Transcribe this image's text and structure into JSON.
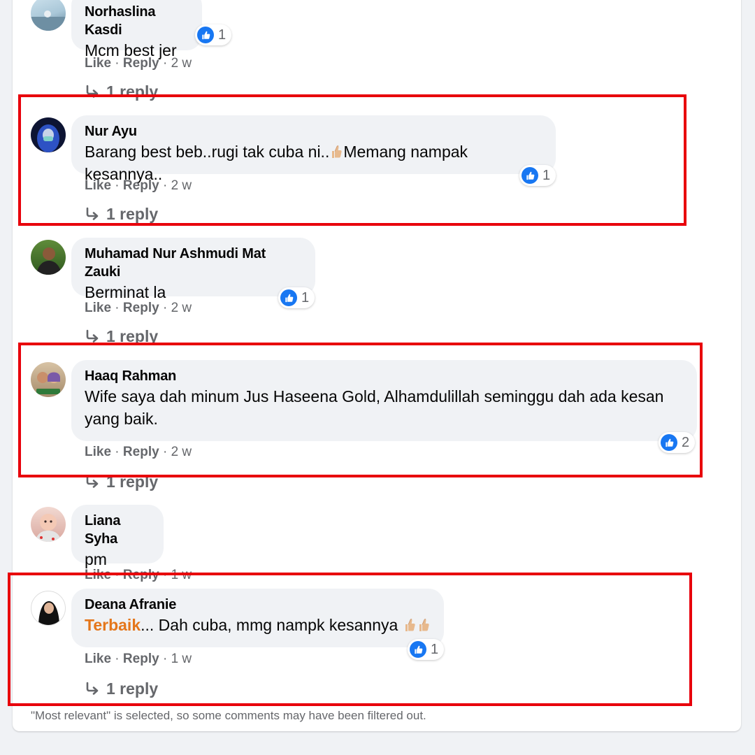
{
  "comments": [
    {
      "author": "Norhaslina Kasdi",
      "text": "Mcm best jer",
      "reactions": "1",
      "like": "Like",
      "reply": "Reply",
      "time": "2 w",
      "replies": "1 reply"
    },
    {
      "author": "Nur Ayu",
      "text_before": "Barang best beb..rugi tak cuba ni..",
      "text_after": "Memang nampak kesannya..",
      "reactions": "1",
      "like": "Like",
      "reply": "Reply",
      "time": "2 w",
      "replies": "1 reply"
    },
    {
      "author": "Muhamad Nur Ashmudi Mat Zauki",
      "text": "Berminat la",
      "reactions": "1",
      "like": "Like",
      "reply": "Reply",
      "time": "2 w",
      "replies": "1 reply"
    },
    {
      "author": "Haaq Rahman",
      "text_line1": "Wife saya dah minum Jus Haseena Gold, Alhamdulillah seminggu dah ada kesan",
      "text_line2": "yang baik.",
      "reactions": "2",
      "like": "Like",
      "reply": "Reply",
      "time": "2 w",
      "replies": "1 reply"
    },
    {
      "author": "Liana Syha",
      "text": "pm",
      "like": "Like",
      "reply": "Reply",
      "time": "1 w"
    },
    {
      "author": "Deana Afranie",
      "text_highlight": "Terbaik",
      "text_rest": "... Dah cuba, mmg nampk kesannya",
      "reactions": "1",
      "like": "Like",
      "reply": "Reply",
      "time": "1 w",
      "replies": "1 reply"
    }
  ],
  "separator": " · ",
  "footer_note": "\"Most relevant\" is selected, so some comments may have been filtered out.",
  "colors": {
    "like_blue": "#1877f2",
    "highlight_box": "#e8000b",
    "bubble_bg": "#f0f2f5",
    "secondary_text": "#65676b",
    "orange_text": "#e4761b"
  },
  "icons": {
    "like": "like-thumb-icon",
    "reply_arrow": "reply-arrow-icon",
    "thumbs_up_emoji": "thumbs-up-emoji-icon"
  }
}
